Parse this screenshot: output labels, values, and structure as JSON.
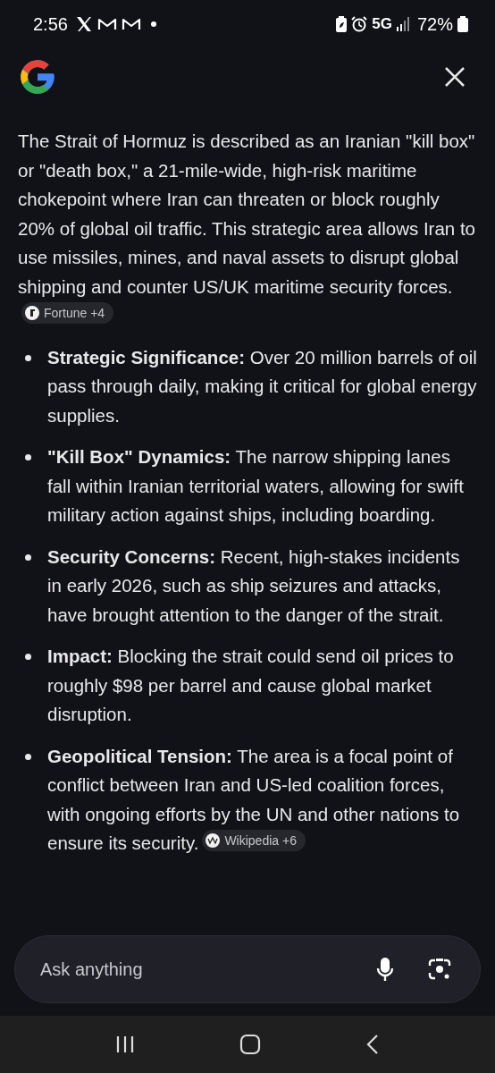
{
  "status_bar": {
    "time": "2:56",
    "network": "5G",
    "battery": "72%"
  },
  "intro": {
    "text": "The Strait of Hormuz is described as an Iranian \"kill box\" or \"death box,\" a 21-mile-wide, high-risk maritime chokepoint where Iran can threaten or block roughly 20% of global oil traffic. This strategic area allows Iran to use missiles, mines, and naval assets to disrupt global shipping and counter US/UK maritime security forces.",
    "citation": "Fortune +4"
  },
  "bullets": [
    {
      "text": "**Strategic Significance:** Over 20 million barrels of oil pass through daily, making it critical for global energy supplies."
    },
    {
      "text": "**\"Kill Box\" Dynamics:** The narrow shipping lanes fall within Iranian territorial waters, allowing for swift military action against ships, including boarding."
    },
    {
      "text": "**Security Concerns:** Recent, high-stakes incidents in early 2026, such as ship seizures and attacks, have brought attention to the danger of the strait."
    },
    {
      "text": "**Impact:** Blocking the strait could send oil prices to roughly $98 per barrel and cause global market disruption."
    },
    {
      "text": "**Geopolitical Tension:** The area is a focal point of conflict between Iran and US-led coalition forces, with ongoing efforts by the UN and other nations to ensure its security.",
      "citation": "Wikipedia +6"
    }
  ],
  "search": {
    "placeholder": "Ask anything"
  }
}
